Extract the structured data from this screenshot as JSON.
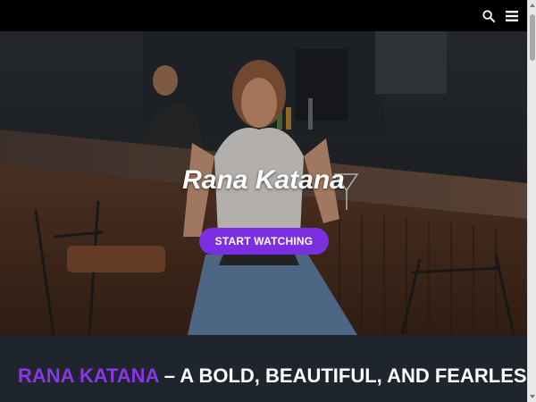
{
  "header": {
    "search_icon": "search-icon",
    "menu_icon": "hamburger-menu-icon"
  },
  "hero": {
    "title": "Rana Katana",
    "cta_label": "START WATCHING"
  },
  "section": {
    "headline_accent": "RANA KATANA",
    "headline_rest": " – A BOLD, BEAUTIFUL, AND FEARLESS"
  },
  "colors": {
    "accent": "#7b2fe0",
    "topbar": "#000000",
    "section_bg": "#1f252c"
  }
}
